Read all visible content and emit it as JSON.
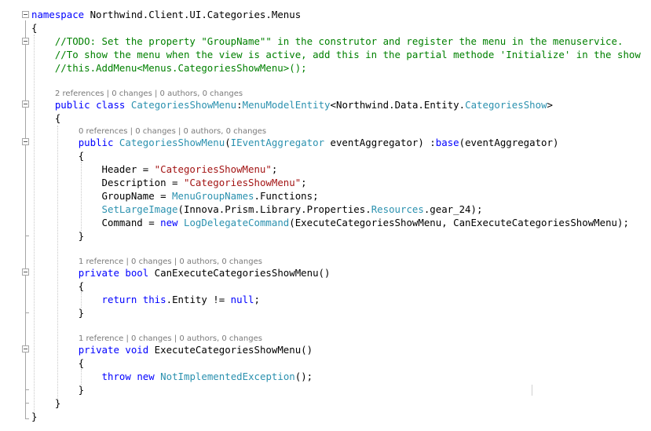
{
  "editor": {
    "lines": {
      "l1": {
        "kw": "namespace",
        "name": " Northwind.Client.UI.Categories.Menus"
      },
      "l2": {
        "text": "{"
      },
      "l3": {
        "text": "    //TODO: Set the property \"GroupName\"\" in the construtor and register the menu in the menuservice."
      },
      "l4": {
        "text": "    //To show the menu when the view is active, add this in the partial methode 'Initialize' in the show"
      },
      "l5": {
        "text": "    //this.AddMenu<Menus.CategoriesShowMenu>();"
      },
      "l7": {
        "indent": "    ",
        "kw1": "public",
        "kw2": "class",
        "cls": "CategoriesShowMenu",
        "colon": ":",
        "base": "MenuModelEntity",
        "lt": "<",
        "ns": "Northwind.Data.Entity.",
        "generic": "CategoriesShow",
        "gt": ">"
      },
      "l8": {
        "text": "    {"
      },
      "l9": {
        "indent": "        ",
        "kw": "public",
        "ctor": "CategoriesShowMenu",
        "open": "(",
        "ptype": "IEventAggregator",
        "pname": " eventAggregator) :",
        "basekw": "base",
        "rest": "(eventAggregator)"
      },
      "l10": {
        "text": "        {"
      },
      "l11": {
        "pre": "            Header = ",
        "str": "\"CategoriesShowMenu\"",
        "post": ";"
      },
      "l12": {
        "pre": "            Description = ",
        "str": "\"CategoriesShowMenu\"",
        "post": ";"
      },
      "l13": {
        "pre": "            GroupName = ",
        "type": "MenuGroupNames",
        "post": ".Functions;"
      },
      "l14": {
        "indent": "            ",
        "method": "SetLargeImage",
        "mid": "(Innova.Prism.Library.Properties.",
        "type": "Resources",
        "post": ".gear_24);"
      },
      "l15": {
        "pre": "            Command = ",
        "kw": "new",
        "sp": " ",
        "type": "LogDelegateCommand",
        "post": "(ExecuteCategoriesShowMenu, CanExecuteCategoriesShowMenu);"
      },
      "l16": {
        "text": "        }"
      },
      "l18": {
        "indent": "        ",
        "kw1": "private",
        "kw2": "bool",
        "name": " CanExecuteCategoriesShowMenu()"
      },
      "l19": {
        "text": "        {"
      },
      "l20": {
        "indent": "            ",
        "kw1": "return",
        "kw2": "this",
        "mid": ".Entity != ",
        "kw3": "null",
        "post": ";"
      },
      "l21": {
        "text": "        }"
      },
      "l23": {
        "indent": "        ",
        "kw1": "private",
        "kw2": "void",
        "name": " ExecuteCategoriesShowMenu()"
      },
      "l24": {
        "text": "        {"
      },
      "l25": {
        "indent": "            ",
        "kw1": "throw",
        "kw2": "new",
        "sp": " ",
        "type": "NotImplementedException",
        "post": "();"
      },
      "l26": {
        "text": "        }"
      },
      "l27": {
        "text": "    }"
      },
      "l28": {
        "text": "}"
      }
    },
    "codelens": {
      "class_lens": {
        "refs": "2 references",
        "changes": "0 changes",
        "authors": "0 authors, 0 changes"
      },
      "ctor_lens": {
        "refs": "0 references",
        "changes": "0 changes",
        "authors": "0 authors, 0 changes"
      },
      "canexec_lens": {
        "refs": "1 reference",
        "changes": "0 changes",
        "authors": "0 authors, 0 changes"
      },
      "exec_lens": {
        "refs": "1 reference",
        "changes": "0 changes",
        "authors": "0 authors, 0 changes"
      },
      "separator": " | "
    },
    "colors": {
      "keyword": "#0000ff",
      "type": "#2b91af",
      "string": "#a31515",
      "comment": "#008000",
      "codelens": "#7a7a7a"
    }
  }
}
